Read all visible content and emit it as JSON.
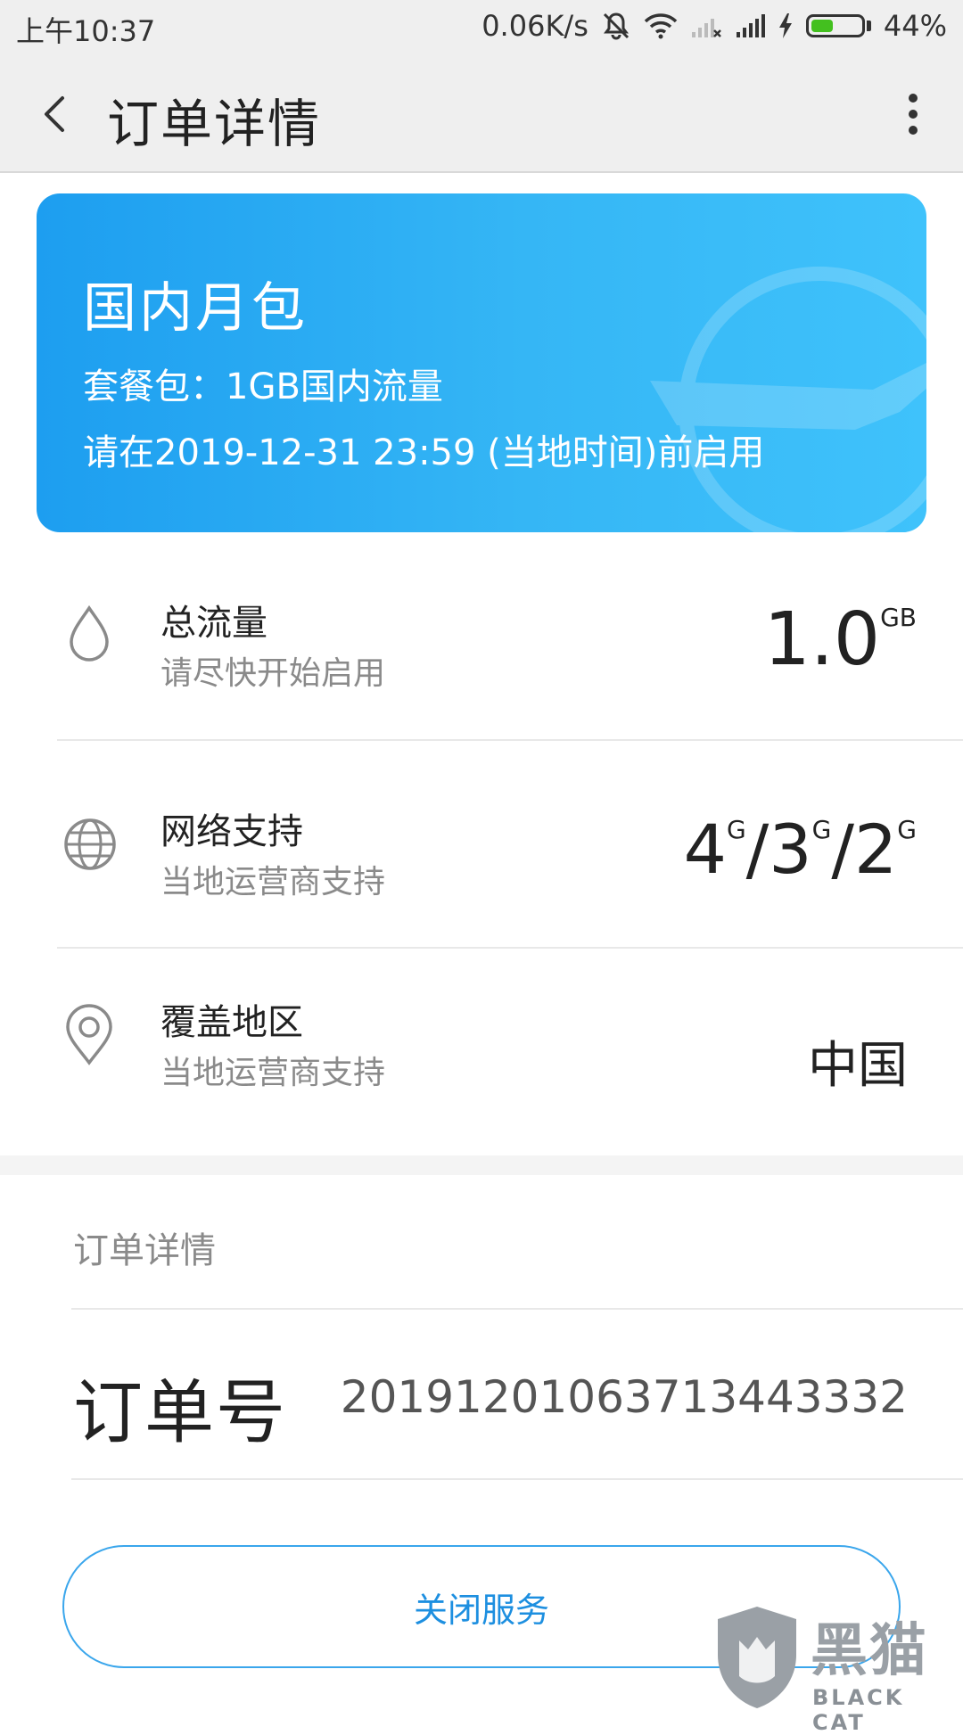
{
  "status_bar": {
    "time": "上午10:37",
    "network_speed": "0.06K/s",
    "battery_percent": "44%",
    "battery_level": 0.44,
    "icons": [
      "mute-icon",
      "wifi-icon",
      "no-signal-sim-icon",
      "signal-icon",
      "charging-icon",
      "battery-icon"
    ]
  },
  "app_bar": {
    "title": "订单详情",
    "back_icon": "back-arrow-icon",
    "more_icon": "more-vertical-icon"
  },
  "package": {
    "name": "国内月包",
    "plan_line": "套餐包：1GB国内流量",
    "activate_before": "请在2019-12-31 23:59 (当地时间)前启用",
    "accent_start": "#1d9ef0",
    "accent_end": "#3fc2fb"
  },
  "rows": {
    "total_data": {
      "title": "总流量",
      "subtitle": "请尽快开始启用",
      "value": "1.0",
      "unit": "GB",
      "icon": "water-drop-icon"
    },
    "network": {
      "title": "网络支持",
      "subtitle": "当地运营商支持",
      "v1": "4",
      "s1": "G",
      "sep1": "/",
      "v2": "3",
      "s2": "G",
      "sep2": "/",
      "v3": "2",
      "s3": "G",
      "icon": "globe-icon"
    },
    "coverage": {
      "title": "覆盖地区",
      "subtitle": "当地运营商支持",
      "value": "中国",
      "icon": "location-pin-icon"
    }
  },
  "order": {
    "section_title": "订单详情",
    "label": "订单号",
    "number": "20191201063713443332"
  },
  "actions": {
    "close_service": "关闭服务",
    "button_color": "#1d8fe0"
  },
  "watermark": {
    "chinese": "黑猫",
    "english": "BLACK CAT"
  }
}
